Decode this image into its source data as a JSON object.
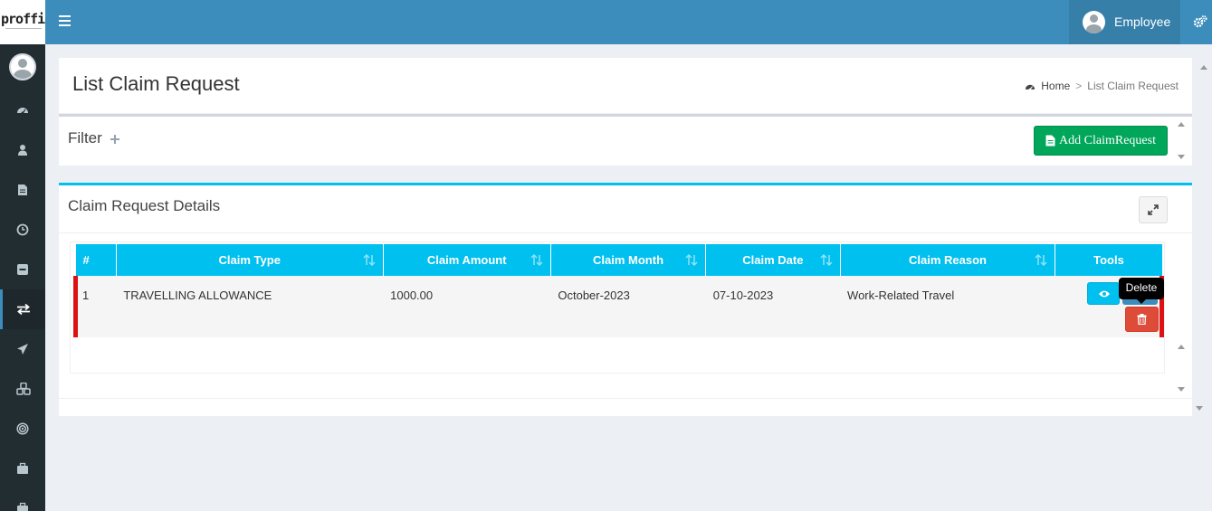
{
  "brand": {
    "logo_text": "proffin"
  },
  "header": {
    "user_name": "Employee"
  },
  "sidebar": {
    "items": [
      {
        "icon": "dashboard-icon"
      },
      {
        "icon": "user-icon"
      },
      {
        "icon": "document-icon"
      },
      {
        "icon": "clock-icon"
      },
      {
        "icon": "minus-square-icon"
      },
      {
        "icon": "exchange-icon",
        "active": true
      },
      {
        "icon": "plane-icon"
      },
      {
        "icon": "cubes-icon"
      },
      {
        "icon": "target-icon"
      },
      {
        "icon": "briefcase-icon"
      },
      {
        "icon": "suitcase-icon"
      }
    ]
  },
  "page": {
    "title": "List Claim Request",
    "breadcrumb": {
      "home": "Home",
      "separator": ">",
      "current": "List Claim Request"
    }
  },
  "filter": {
    "title": "Filter",
    "add_button": "Add ClaimRequest"
  },
  "details": {
    "title": "Claim Request Details",
    "columns": [
      "#",
      "Claim Type",
      "Claim Amount",
      "Claim Month",
      "Claim Date",
      "Claim Reason",
      "Tools"
    ],
    "rows": [
      {
        "no": "1",
        "claim_type": "TRAVELLING ALLOWANCE",
        "claim_amount": "1000.00",
        "claim_month": "October-2023",
        "claim_date": "07-10-2023",
        "claim_reason": "Work-Related Travel"
      }
    ],
    "tooltip": "Delete"
  },
  "colors": {
    "header": "#3c8dbc",
    "sidebar": "#222d32",
    "table_header": "#00c0ef",
    "add_button": "#00a65a",
    "delete_button": "#dd4b39",
    "row_highlight": "#dd1111"
  }
}
